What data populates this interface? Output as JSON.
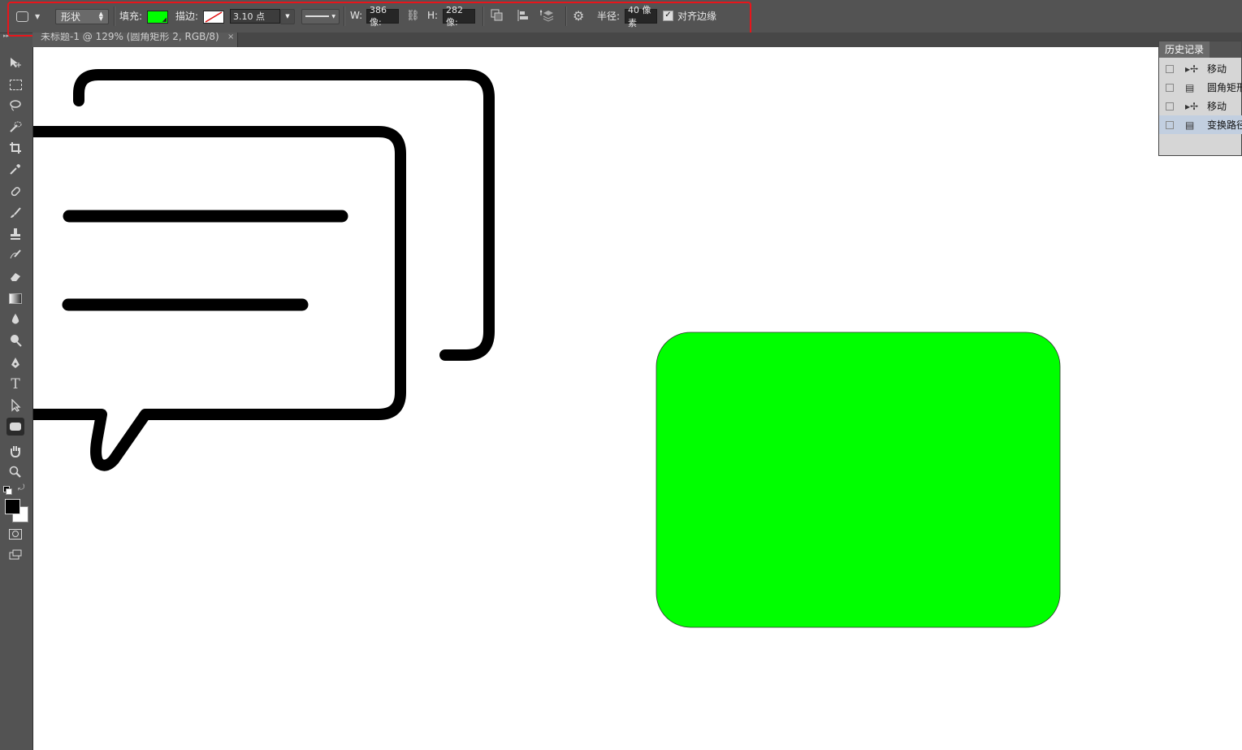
{
  "options_bar": {
    "tool_mode": "形状",
    "fill_label": "填充:",
    "fill_color": "#00ff00",
    "stroke_label": "描边:",
    "stroke_size": "3.10 点",
    "width_label": "W:",
    "width_value": "386 像:",
    "height_label": "H:",
    "height_value": "282 像:",
    "radius_label": "半径:",
    "radius_value": "40 像素",
    "align_edges_label": "对齐边缘"
  },
  "document_tab": {
    "title": "未标题-1 @ 129% (圆角矩形 2, RGB/8)",
    "close": "×"
  },
  "history_panel": {
    "title": "历史记录",
    "items": [
      {
        "label": "移动",
        "icon": "move-icon"
      },
      {
        "label": "圆角矩形",
        "icon": "document-icon"
      },
      {
        "label": "移动",
        "icon": "move-icon"
      },
      {
        "label": "变换路径",
        "icon": "document-icon",
        "selected": true
      }
    ]
  },
  "colors": {
    "foreground": "#000000",
    "background": "#ffffff",
    "shape_fill": "#00ff00",
    "highlight": "#e8151b"
  }
}
